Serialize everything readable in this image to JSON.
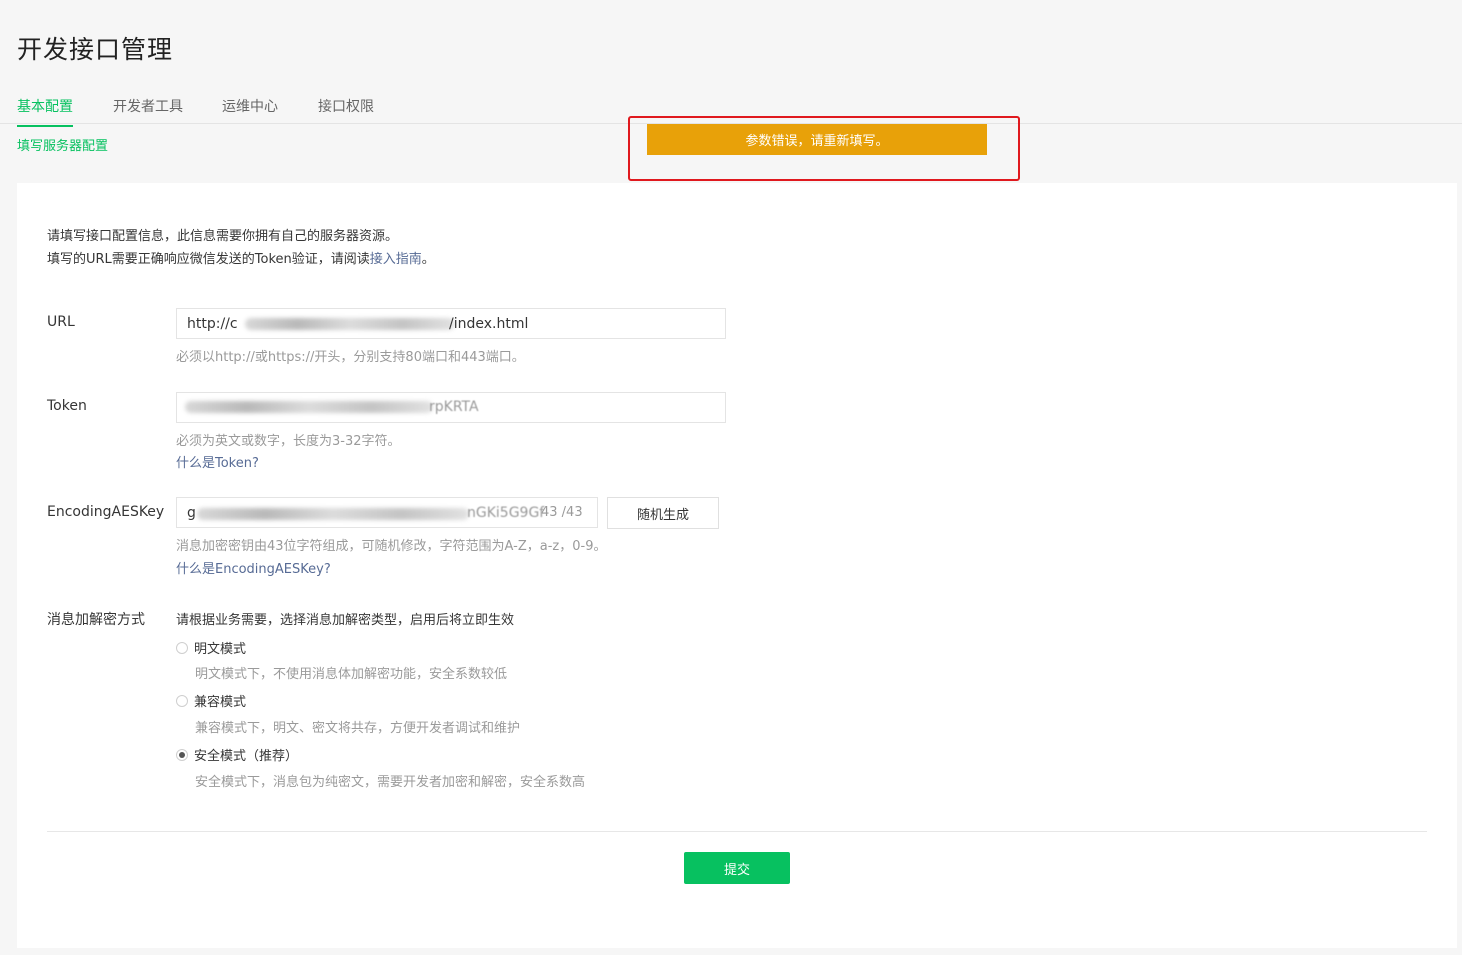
{
  "page": {
    "title": "开发接口管理"
  },
  "tabs": [
    {
      "label": "基本配置",
      "active": true
    },
    {
      "label": "开发者工具",
      "active": false
    },
    {
      "label": "运维中心",
      "active": false
    },
    {
      "label": "接口权限",
      "active": false
    }
  ],
  "subnav": {
    "label": "填写服务器配置"
  },
  "toast": {
    "message": "参数错误，请重新填写。",
    "color": "#e8a109"
  },
  "intro": {
    "line1": "请填写接口配置信息，此信息需要你拥有自己的服务器资源。",
    "line2_prefix": "填写的URL需要正确响应微信发送的Token验证，请阅读",
    "line2_link": "接入指南",
    "line2_suffix": "。"
  },
  "form": {
    "url": {
      "label": "URL",
      "value_start": "http://c",
      "value_end": "/index.html",
      "hint": "必须以http://或https://开头，分别支持80端口和443端口。"
    },
    "token": {
      "label": "Token",
      "value_end": "rpKRTA",
      "hint": "必须为英文或数字，长度为3-32字符。",
      "help_link": "什么是Token?"
    },
    "aes": {
      "label": "EncodingAESKey",
      "value_start": "g",
      "value_end": "nGKi5G9Gf",
      "counter": "43 /43",
      "generate_label": "随机生成",
      "hint": "消息加密密钥由43位字符组成，可随机修改，字符范围为A-Z，a-z，0-9。",
      "help_link": "什么是EncodingAESKey?"
    },
    "encryption": {
      "label": "消息加解密方式",
      "instruction": "请根据业务需要，选择消息加解密类型，启用后将立即生效",
      "options": [
        {
          "label": "明文模式",
          "desc": "明文模式下，不使用消息体加解密功能，安全系数较低",
          "checked": false
        },
        {
          "label": "兼容模式",
          "desc": "兼容模式下，明文、密文将共存，方便开发者调试和维护",
          "checked": false
        },
        {
          "label": "安全模式（推荐）",
          "desc": "安全模式下，消息包为纯密文，需要开发者加密和解密，安全系数高",
          "checked": true
        }
      ]
    }
  },
  "submit_label": "提交",
  "colors": {
    "accent": "#07c160",
    "link": "#576b95",
    "highlight": "#e0191e"
  }
}
